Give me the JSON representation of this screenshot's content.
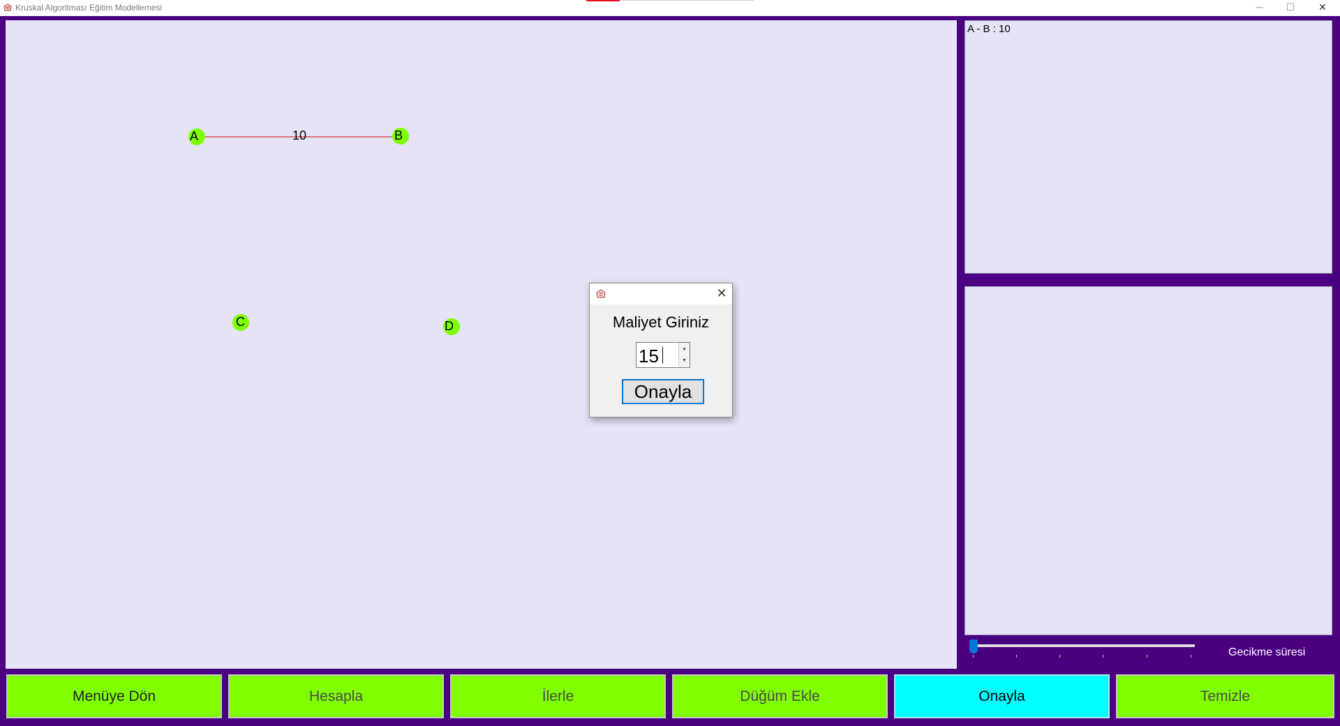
{
  "window": {
    "title": "Kruskal Algoritması Eğitim Modellemesi",
    "controls": {
      "minimize": "─",
      "maximize": "☐",
      "close": "✕"
    }
  },
  "graph": {
    "nodes": [
      {
        "label": "A"
      },
      {
        "label": "B"
      },
      {
        "label": "C"
      },
      {
        "label": "D"
      }
    ],
    "edges": [
      {
        "from": "A",
        "to": "B",
        "cost": "10"
      }
    ],
    "node_color": "#7fff00",
    "edge_color": "#e00000"
  },
  "edges_list": {
    "entries": [
      "A - B : 10"
    ]
  },
  "delay": {
    "label": "Gecikme süresi",
    "value_fraction": 0
  },
  "buttons": {
    "menu": "Menüye Dön",
    "calculate": "Hesapla",
    "next": "İlerle",
    "add_node": "Düğüm Ekle",
    "confirm": "Onayla",
    "clear": "Temizle"
  },
  "dialog": {
    "close": "✕",
    "prompt": "Maliyet Giriniz",
    "value": "15",
    "confirm": "Onayla"
  },
  "colors": {
    "background": "#4b0082",
    "panel": "#e4e4f6",
    "button": "#7fff00",
    "active_button": "#00ffff"
  }
}
